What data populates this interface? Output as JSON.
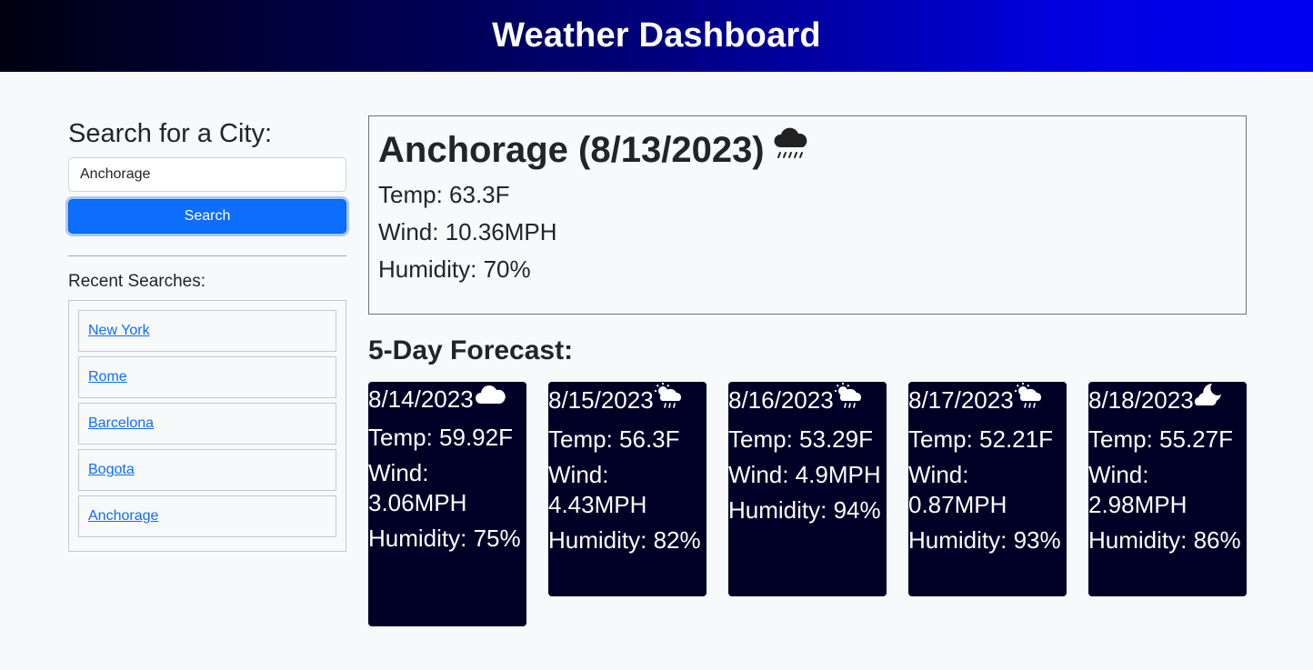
{
  "header": {
    "title": "Weather Dashboard"
  },
  "sidebar": {
    "search_title": "Search for a City:",
    "search_value": "Anchorage",
    "search_button": "Search",
    "recent_title": "Recent Searches:",
    "recent": [
      "New York",
      "Rome",
      "Barcelona",
      "Bogota",
      "Anchorage"
    ]
  },
  "current": {
    "title": "Anchorage (8/13/2023)",
    "icon": "rain-cloud-icon",
    "temp": "Temp: 63.3F",
    "wind": "Wind: 10.36MPH",
    "humidity": "Humidity: 70%"
  },
  "forecast": {
    "title": "5-Day Forecast:",
    "days": [
      {
        "date": "8/14/2023",
        "icon": "cloud-icon",
        "temp": "Temp: 59.92F",
        "wind": "Wind: 3.06MPH",
        "humidity": "Humidity: 75%"
      },
      {
        "date": "8/15/2023",
        "icon": "sun-rain-cloud-icon",
        "temp": "Temp: 56.3F",
        "wind": "Wind: 4.43MPH",
        "humidity": "Humidity: 82%"
      },
      {
        "date": "8/16/2023",
        "icon": "sun-rain-cloud-icon",
        "temp": "Temp: 53.29F",
        "wind": "Wind: 4.9MPH",
        "humidity": "Humidity: 94%"
      },
      {
        "date": "8/17/2023",
        "icon": "sun-rain-cloud-icon",
        "temp": "Temp: 52.21F",
        "wind": "Wind: 0.87MPH",
        "humidity": "Humidity: 93%"
      },
      {
        "date": "8/18/2023",
        "icon": "moon-cloud-icon",
        "temp": "Temp: 55.27F",
        "wind": "Wind: 2.98MPH",
        "humidity": "Humidity: 86%"
      }
    ]
  },
  "colors": {
    "header_start": "#000010",
    "header_end": "#0000f2",
    "button": "#0d6efd",
    "card_bg": "#000026",
    "link": "#0d6efd"
  }
}
